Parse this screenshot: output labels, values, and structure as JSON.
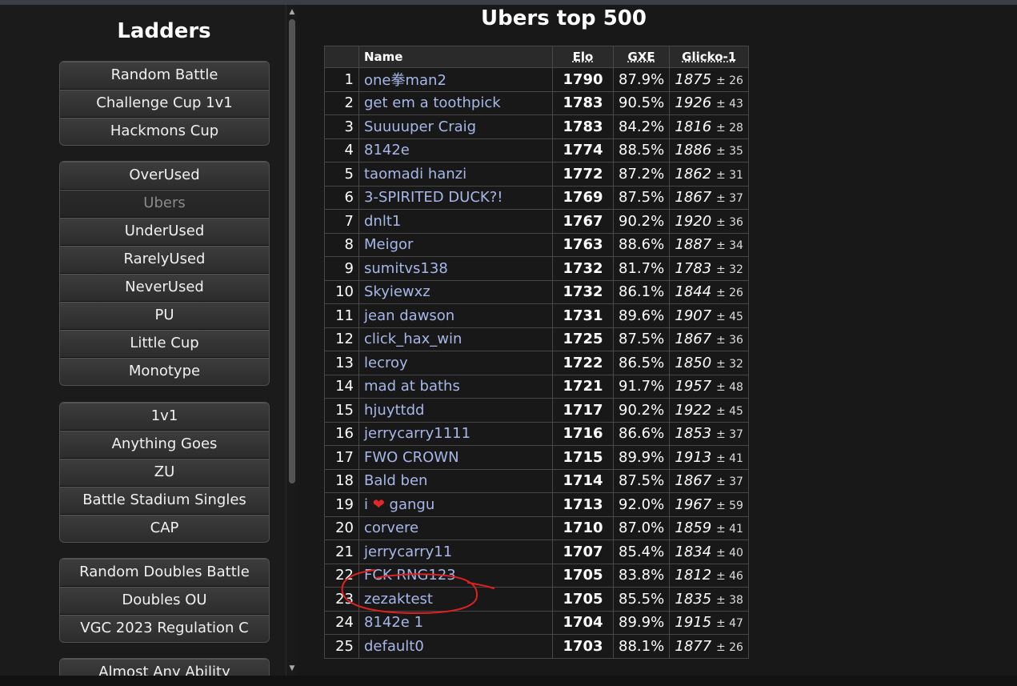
{
  "sidebar": {
    "title": "Ladders",
    "groups": [
      [
        "Random Battle",
        "Challenge Cup 1v1",
        "Hackmons Cup"
      ],
      [
        "OverUsed",
        "Ubers",
        "UnderUsed",
        "RarelyUsed",
        "NeverUsed",
        "PU",
        "Little Cup",
        "Monotype"
      ],
      [
        "1v1",
        "Anything Goes",
        "ZU",
        "Battle Stadium Singles",
        "CAP"
      ],
      [
        "Random Doubles Battle",
        "Doubles OU",
        "VGC 2023 Regulation C"
      ],
      [
        "Almost Any Ability"
      ]
    ],
    "current": "Ubers"
  },
  "main": {
    "title": "Ubers top 500",
    "columns": {
      "rank": "",
      "name": "Name",
      "elo": "Elo",
      "gxe": "GXE",
      "glicko": "Glicko-1"
    },
    "rows": [
      {
        "rank": "1",
        "name": "one拳man2",
        "elo": "1790",
        "gxe": "87.9%",
        "glicko": "1875",
        "dev": "± 26"
      },
      {
        "rank": "2",
        "name": "get em a toothpick",
        "elo": "1783",
        "gxe": "90.5%",
        "glicko": "1926",
        "dev": "± 43"
      },
      {
        "rank": "3",
        "name": "Suuuuper Craig",
        "elo": "1783",
        "gxe": "84.2%",
        "glicko": "1816",
        "dev": "± 28"
      },
      {
        "rank": "4",
        "name": "8142e",
        "elo": "1774",
        "gxe": "88.5%",
        "glicko": "1886",
        "dev": "± 35"
      },
      {
        "rank": "5",
        "name": "taomadi hanzi",
        "elo": "1772",
        "gxe": "87.2%",
        "glicko": "1862",
        "dev": "± 31"
      },
      {
        "rank": "6",
        "name": "3-SPIRITED DUCK?!",
        "elo": "1769",
        "gxe": "87.5%",
        "glicko": "1867",
        "dev": "± 37"
      },
      {
        "rank": "7",
        "name": "dnlt1",
        "elo": "1767",
        "gxe": "90.2%",
        "glicko": "1920",
        "dev": "± 36"
      },
      {
        "rank": "8",
        "name": "Meigor",
        "elo": "1763",
        "gxe": "88.6%",
        "glicko": "1887",
        "dev": "± 34"
      },
      {
        "rank": "9",
        "name": "sumitvs138",
        "elo": "1732",
        "gxe": "81.7%",
        "glicko": "1783",
        "dev": "± 32"
      },
      {
        "rank": "10",
        "name": "Skyiewxz",
        "elo": "1732",
        "gxe": "86.1%",
        "glicko": "1844",
        "dev": "± 26"
      },
      {
        "rank": "11",
        "name": "jean dawson",
        "elo": "1731",
        "gxe": "89.6%",
        "glicko": "1907",
        "dev": "± 45"
      },
      {
        "rank": "12",
        "name": "click_hax_win",
        "elo": "1725",
        "gxe": "87.5%",
        "glicko": "1867",
        "dev": "± 36"
      },
      {
        "rank": "13",
        "name": "lecroy",
        "elo": "1722",
        "gxe": "86.5%",
        "glicko": "1850",
        "dev": "± 32"
      },
      {
        "rank": "14",
        "name": "mad at baths",
        "elo": "1721",
        "gxe": "91.7%",
        "glicko": "1957",
        "dev": "± 48"
      },
      {
        "rank": "15",
        "name": "hjuyttdd",
        "elo": "1717",
        "gxe": "90.2%",
        "glicko": "1922",
        "dev": "± 45"
      },
      {
        "rank": "16",
        "name": "jerrycarry1111",
        "elo": "1716",
        "gxe": "86.6%",
        "glicko": "1853",
        "dev": "± 37"
      },
      {
        "rank": "17",
        "name": "FWO CROWN",
        "elo": "1715",
        "gxe": "89.9%",
        "glicko": "1913",
        "dev": "± 41"
      },
      {
        "rank": "18",
        "name": "Bald ben",
        "elo": "1714",
        "gxe": "87.5%",
        "glicko": "1867",
        "dev": "± 37"
      },
      {
        "rank": "19",
        "name": "i ❤ gangu",
        "elo": "1713",
        "gxe": "92.0%",
        "glicko": "1967",
        "dev": "± 59"
      },
      {
        "rank": "20",
        "name": "corvere",
        "elo": "1710",
        "gxe": "87.0%",
        "glicko": "1859",
        "dev": "± 41"
      },
      {
        "rank": "21",
        "name": "jerrycarry11",
        "elo": "1707",
        "gxe": "85.4%",
        "glicko": "1834",
        "dev": "± 40"
      },
      {
        "rank": "22",
        "name": "FCK RNG123",
        "elo": "1705",
        "gxe": "83.8%",
        "glicko": "1812",
        "dev": "± 46"
      },
      {
        "rank": "23",
        "name": "zezaktest",
        "elo": "1705",
        "gxe": "85.5%",
        "glicko": "1835",
        "dev": "± 38"
      },
      {
        "rank": "24",
        "name": "8142e 1",
        "elo": "1704",
        "gxe": "89.9%",
        "glicko": "1915",
        "dev": "± 47"
      },
      {
        "rank": "25",
        "name": "default0",
        "elo": "1703",
        "gxe": "88.1%",
        "glicko": "1877",
        "dev": "± 26"
      }
    ]
  },
  "colors": {
    "name_link": "#a7b7e8",
    "annotation": "#e02020",
    "heart": "#e0272b"
  }
}
